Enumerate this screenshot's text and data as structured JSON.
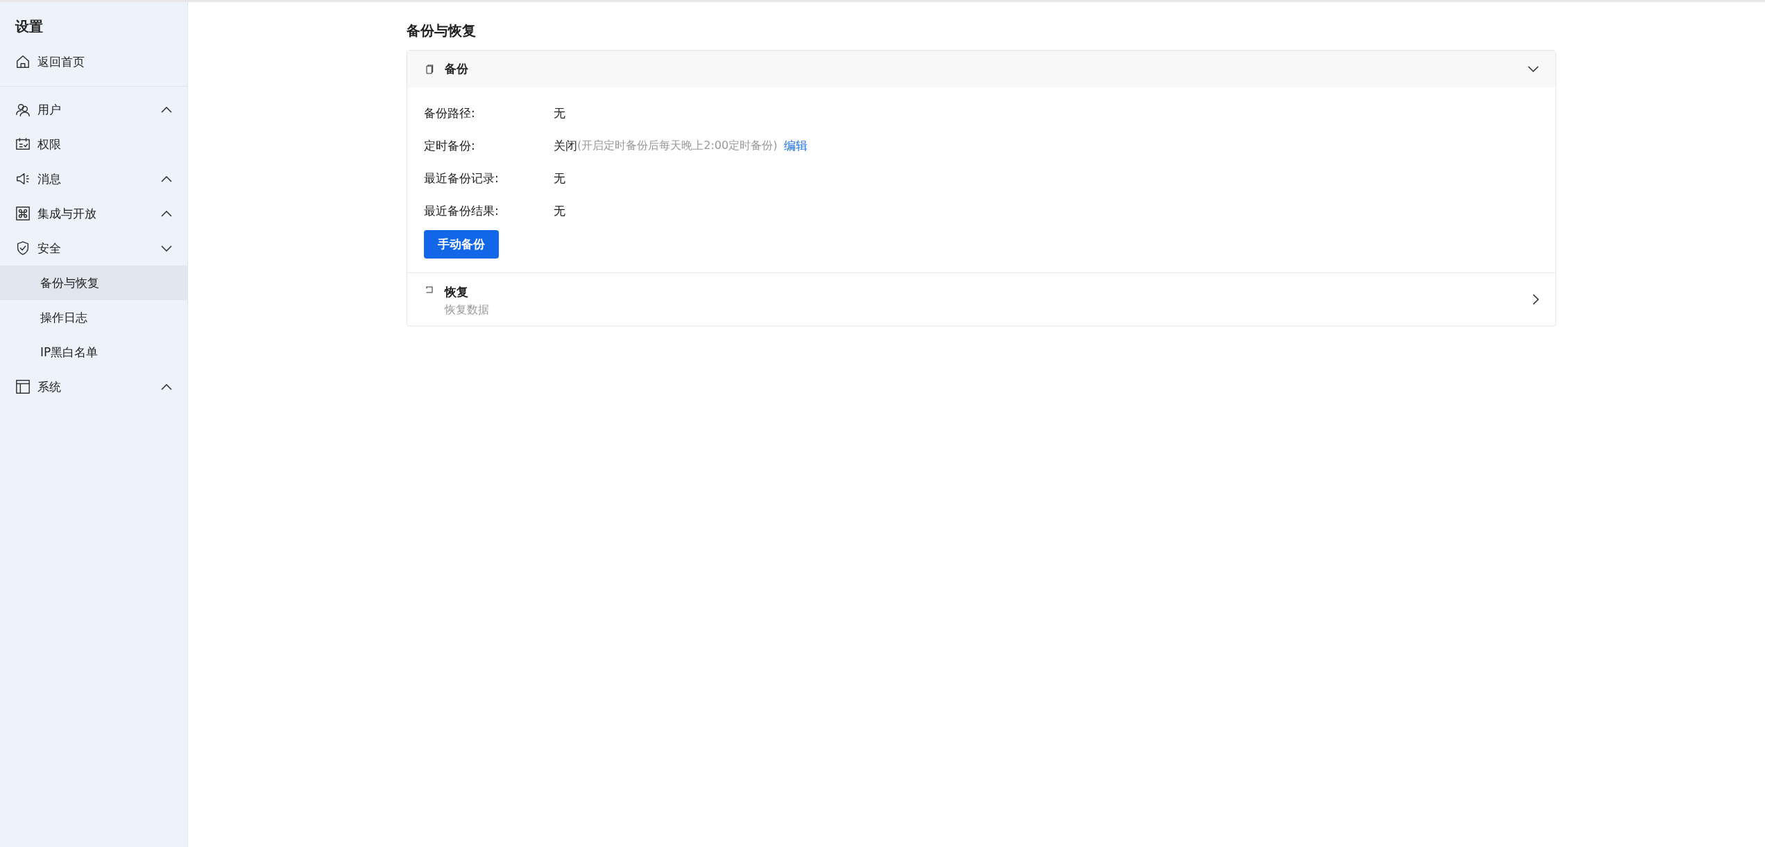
{
  "sidebar": {
    "title": "设置",
    "home": {
      "label": "返回首页"
    },
    "items": [
      {
        "label": "用户",
        "expanded": false
      },
      {
        "label": "权限"
      },
      {
        "label": "消息",
        "expanded": false
      },
      {
        "label": "集成与开放",
        "expanded": false
      },
      {
        "label": "安全",
        "expanded": true,
        "children": [
          {
            "label": "备份与恢复",
            "selected": true
          },
          {
            "label": "操作日志",
            "selected": false
          },
          {
            "label": "IP黑白名单",
            "selected": false
          }
        ]
      },
      {
        "label": "系统",
        "expanded": false
      }
    ]
  },
  "main": {
    "title": "备份与恢复",
    "sections": [
      {
        "title": "备份",
        "expanded": true,
        "fields": [
          {
            "label": "备份路径:",
            "value": "无"
          },
          {
            "label": "定时备份:",
            "value": "关闭",
            "note": "(开启定时备份后每天晚上2:00定时备份)",
            "link": "编辑"
          },
          {
            "label": "最近备份记录:",
            "value": "无"
          },
          {
            "label": "最近备份结果:",
            "value": "无"
          }
        ],
        "button": "手动备份"
      },
      {
        "title": "恢复",
        "subtitle": "恢复数据",
        "expanded": false
      }
    ]
  }
}
